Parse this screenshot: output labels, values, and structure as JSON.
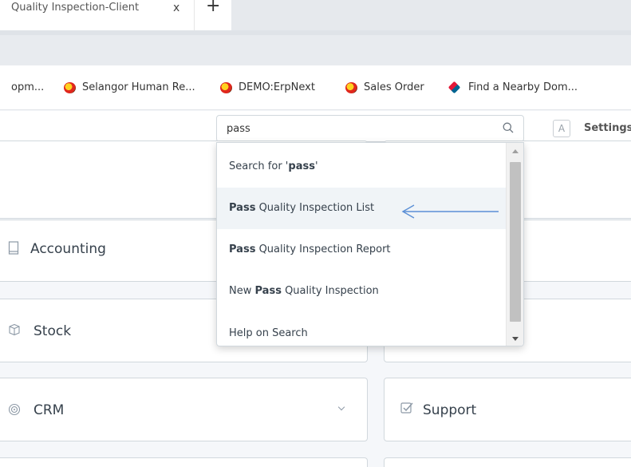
{
  "browser": {
    "tab_title": "Quality Inspection-Client",
    "tab_close": "x",
    "new_tab": "+"
  },
  "bookmarks": [
    {
      "label": "opm...",
      "icon": "none"
    },
    {
      "label": "Selangor Human Re...",
      "icon": "selangor-logo-icon"
    },
    {
      "label": "DEMO:ErpNext",
      "icon": "selangor-logo-icon"
    },
    {
      "label": "Sales Order",
      "icon": "selangor-logo-icon"
    },
    {
      "label": "Find a Nearby Dom...",
      "icon": "dominos-logo-icon"
    }
  ],
  "navbar": {
    "search_value": "pass",
    "avatar_letter": "A",
    "settings_label": "Settings"
  },
  "dropdown": {
    "items": [
      {
        "prefix": "Search for '",
        "bold": "pass",
        "suffix": "'"
      },
      {
        "prefix": "",
        "bold": "Pass",
        "suffix": " Quality Inspection List",
        "active": true
      },
      {
        "prefix": "",
        "bold": "Pass",
        "suffix": " Quality Inspection Report"
      },
      {
        "prefix": "New ",
        "bold": "Pass",
        "suffix": " Quality Inspection"
      },
      {
        "prefix": "Help on Search",
        "bold": "",
        "suffix": ""
      }
    ]
  },
  "modules": {
    "accounting": "Accounting",
    "stock": "Stock",
    "crm": "CRM",
    "support": "Support"
  },
  "colors": {
    "annotation_arrow": "#5b8fd6",
    "active_row": "#f0f4f7"
  }
}
